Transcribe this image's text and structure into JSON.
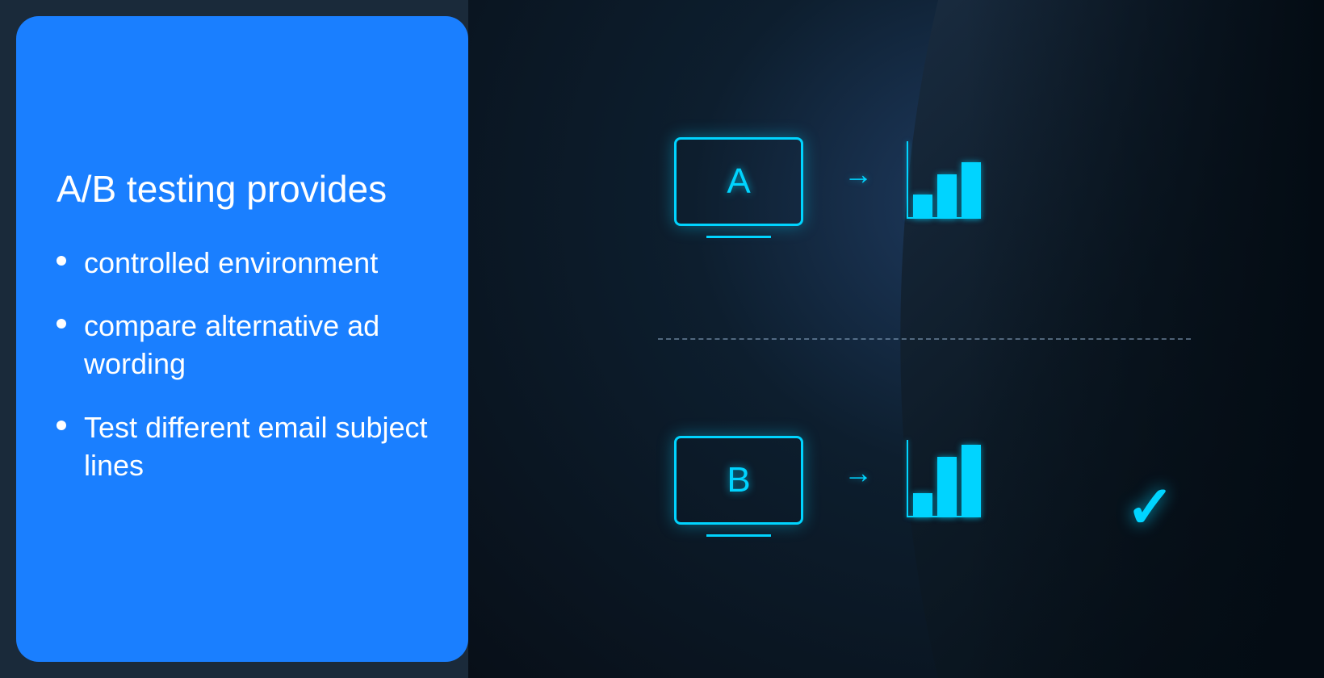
{
  "left": {
    "title": "A/B testing provides",
    "bullets": [
      {
        "id": "bullet-1",
        "text": "controlled environment"
      },
      {
        "id": "bullet-2",
        "text": "compare alternative ad wording"
      },
      {
        "id": "bullet-3",
        "text": "Test different email subject lines"
      }
    ]
  },
  "right": {
    "version_a_label": "A",
    "version_b_label": "B",
    "checkmark": "✓",
    "arrow": "→",
    "bars_a": [
      30,
      55,
      70
    ],
    "bars_b": [
      30,
      75,
      90
    ]
  },
  "colors": {
    "accent": "#00d4ff",
    "panel_bg": "#1a7fff",
    "dark_bg": "#0d1e2e"
  }
}
